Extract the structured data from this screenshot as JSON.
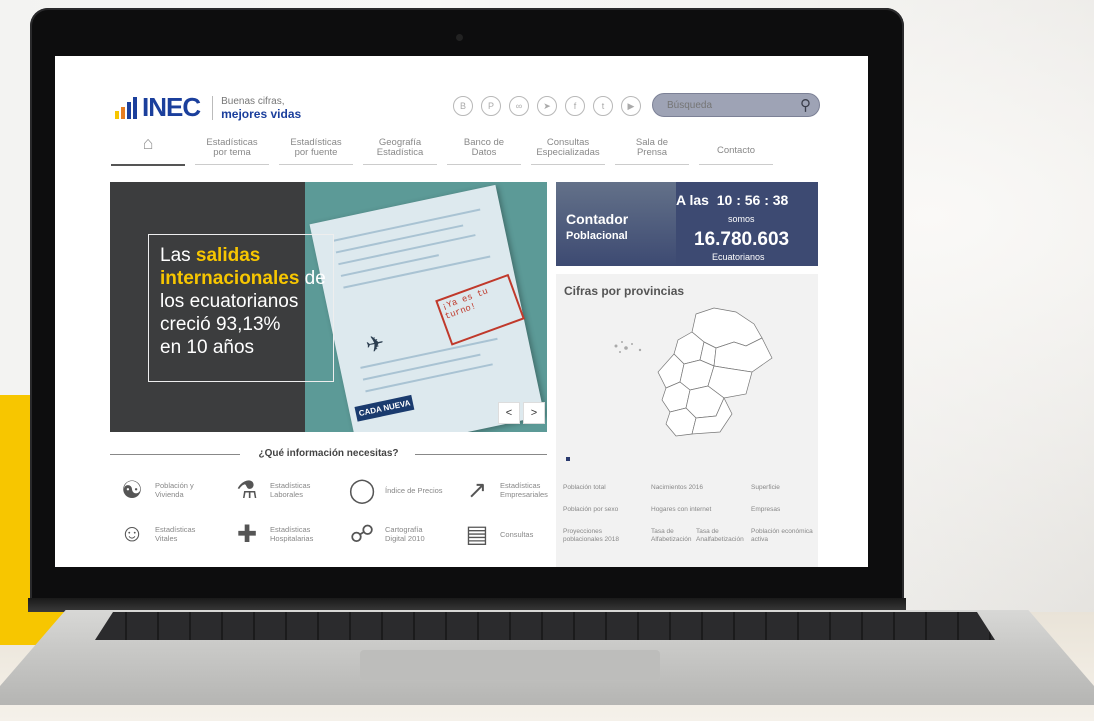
{
  "header": {
    "logo_text": "INEC",
    "tagline_line1": "Buenas cifras,",
    "tagline_line2": "mejores vidas",
    "logo_bar_colors": [
      "#f7c600",
      "#e67e22",
      "#1b3f9c",
      "#1b3f9c"
    ],
    "social_icons": [
      "blog-icon",
      "pinterest-icon",
      "flickr-icon",
      "telegram-icon",
      "facebook-icon",
      "twitter-icon",
      "youtube-icon"
    ],
    "search_placeholder": "Búsqueda"
  },
  "nav": {
    "items": [
      {
        "label": "",
        "icon": "home-icon"
      },
      {
        "label_1": "Estadísticas",
        "label_2": "por tema"
      },
      {
        "label_1": "Estadísticas",
        "label_2": "por fuente"
      },
      {
        "label_1": "Geografía",
        "label_2": "Estadística"
      },
      {
        "label_1": "Banco de",
        "label_2": "Datos"
      },
      {
        "label_1": "Consultas",
        "label_2": "Especializadas"
      },
      {
        "label_1": "Sala de",
        "label_2": "Prensa"
      },
      {
        "label_1": "Contacto",
        "label_2": ""
      }
    ]
  },
  "slider": {
    "text_pre": "Las ",
    "highlight": "salidas internacionales",
    "text_post_1": " de",
    "line_3": "los ecuatorianos",
    "line_4": "creció 93,13%",
    "line_5": "en 10 años",
    "prev": "<",
    "next": ">",
    "paper_stamp": "¡Ya es tu turno!",
    "paper_cada": "CADA NUEVA"
  },
  "contador": {
    "title": "Contador",
    "subtitle": "Poblacional",
    "time_prefix": "A las",
    "time": "10 : 56 : 38",
    "somos": "somos",
    "number": "16.780.603",
    "unit": "Ecuatorianos"
  },
  "provincias": {
    "title": "Cifras por provincias",
    "stats": [
      "Población total",
      "Nacimientos 2016",
      "Superficie",
      "Población por sexo",
      "Hogares con internet",
      "Empresas",
      "Proyecciones poblacionales 2018",
      "Tasa de Alfabetización",
      "Tasa de Analfabetización",
      "Población económica activa"
    ]
  },
  "info": {
    "title": "¿Qué información necesitas?",
    "categories": [
      {
        "label": "Población y Vivienda",
        "icon": "people-icon"
      },
      {
        "label": "Estadísticas Laborales",
        "icon": "worker-icon"
      },
      {
        "label": "Índice de Precios",
        "icon": "prices-icon"
      },
      {
        "label": "Estadísticas Empresariales",
        "icon": "growth-chart-icon"
      },
      {
        "label": "Estadísticas Vitales",
        "icon": "baby-icon"
      },
      {
        "label": "Estadísticas Hospitalarias",
        "icon": "hospital-icon"
      },
      {
        "label": "Cartografía Digital 2010",
        "icon": "map-icon"
      },
      {
        "label": "Consultas",
        "icon": "consultas-icon"
      }
    ]
  }
}
